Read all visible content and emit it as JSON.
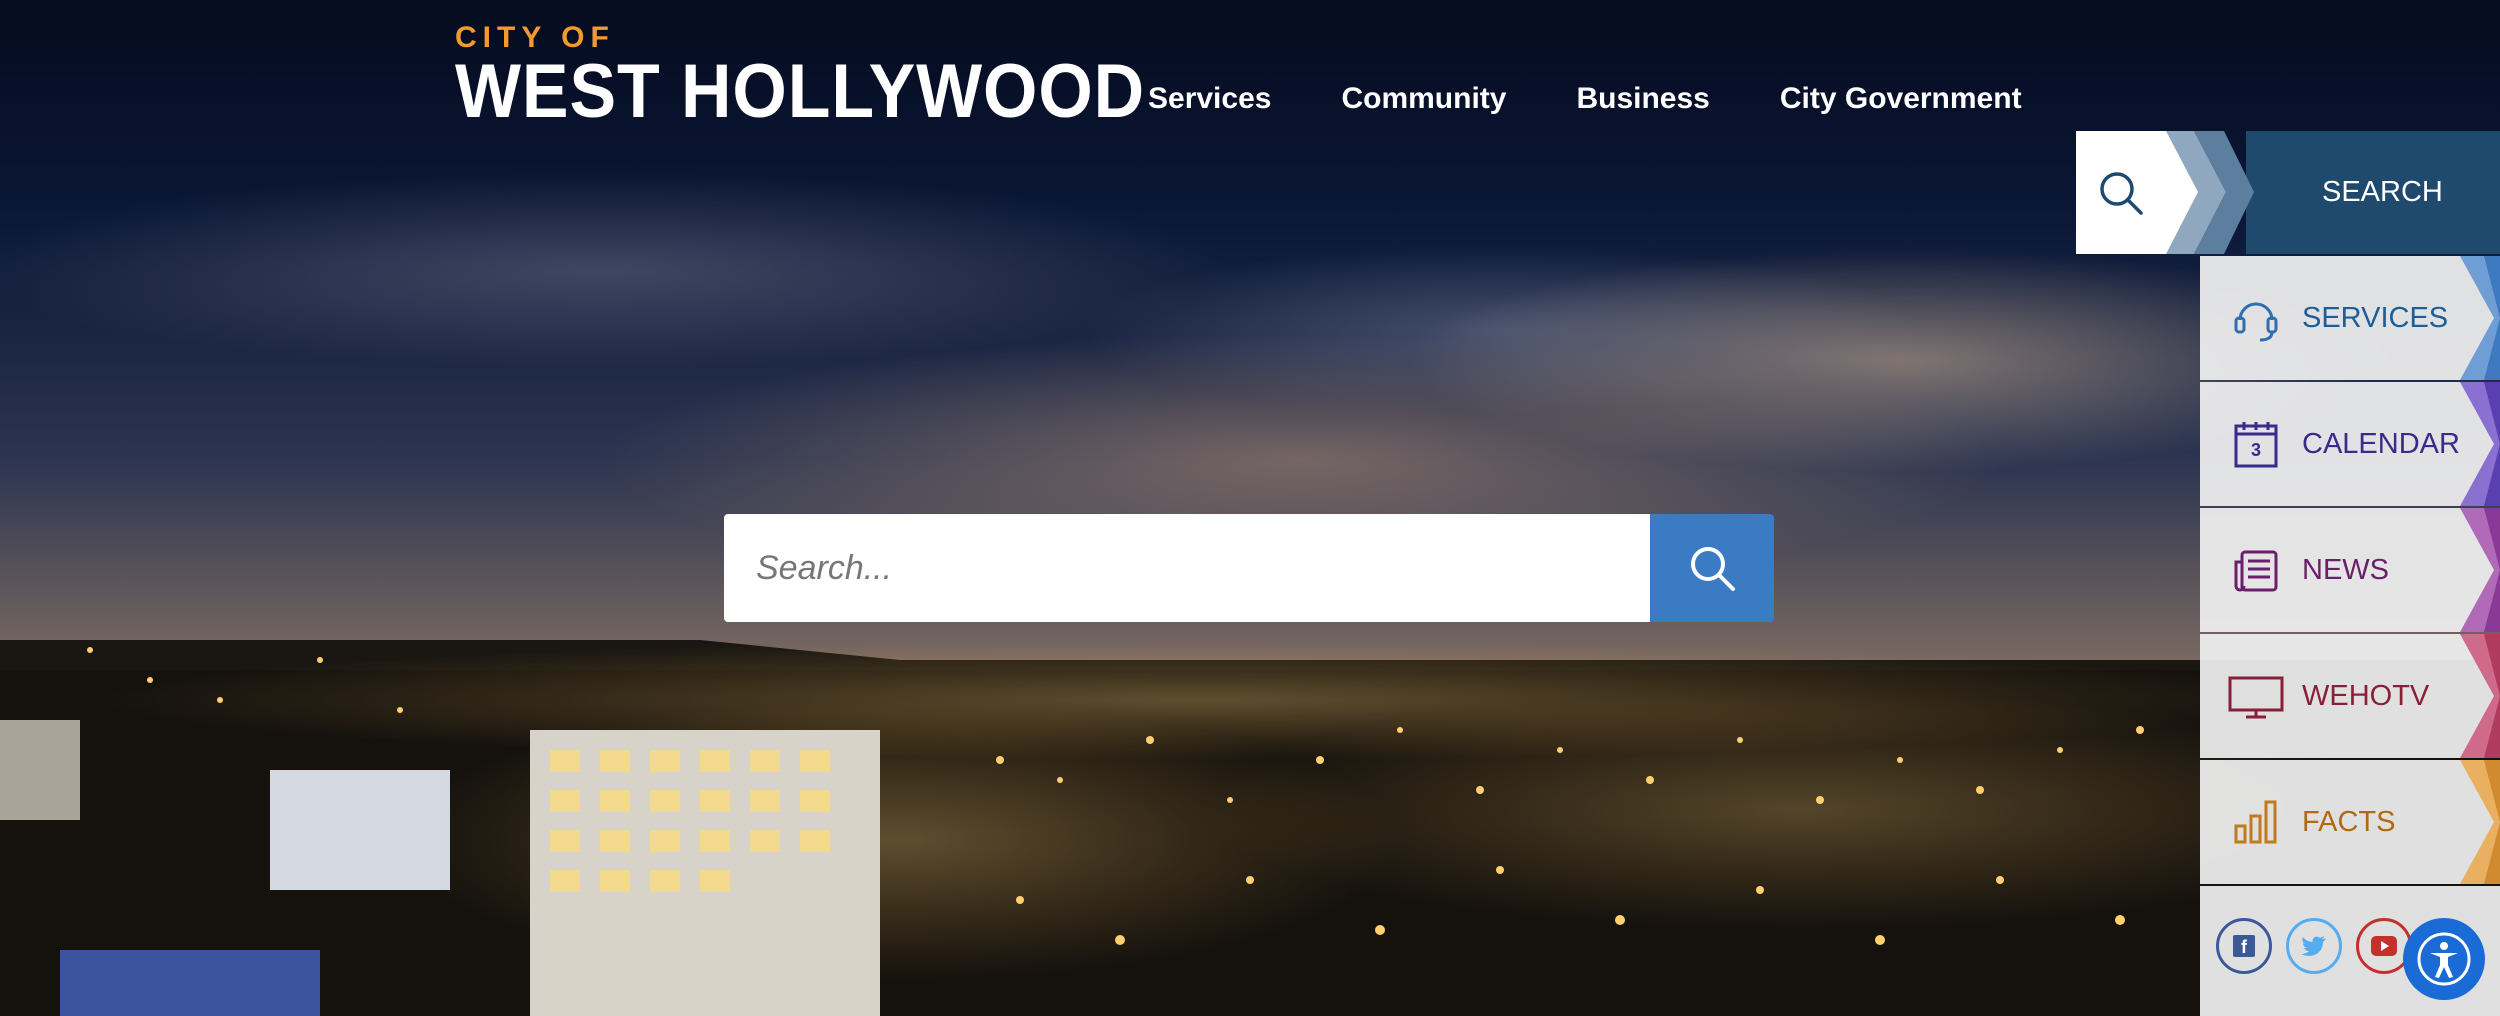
{
  "header": {
    "logo_sub": "CITY OF",
    "logo_main": "WEST HOLLYWOOD",
    "nav": [
      "Services",
      "Community",
      "Business",
      "City Government"
    ]
  },
  "search": {
    "placeholder": "Search...",
    "button_icon": "search-icon"
  },
  "side": {
    "search_label": "SEARCH",
    "items": [
      {
        "label": "SERVICES",
        "icon": "headset-icon",
        "color": "#1f5d99"
      },
      {
        "label": "CALENDAR",
        "icon": "calendar-icon",
        "calendar_day": "3",
        "color": "#3a2a8a"
      },
      {
        "label": "NEWS",
        "icon": "newspaper-icon",
        "color": "#6a1f6a"
      },
      {
        "label": "WEHOTV",
        "icon": "monitor-icon",
        "color": "#8a1f3a"
      },
      {
        "label": "FACTS",
        "icon": "bar-chart-icon",
        "color": "#b06a10"
      }
    ]
  },
  "social": [
    {
      "name": "facebook",
      "icon": "facebook-icon",
      "glyph": "f",
      "color": "#3b5998"
    },
    {
      "name": "twitter",
      "icon": "twitter-icon",
      "glyph": "🐦",
      "color": "#55acee"
    },
    {
      "name": "youtube",
      "icon": "youtube-icon",
      "glyph": "▶",
      "color": "#c4302b"
    }
  ],
  "accessibility_icon": "accessibility-icon"
}
